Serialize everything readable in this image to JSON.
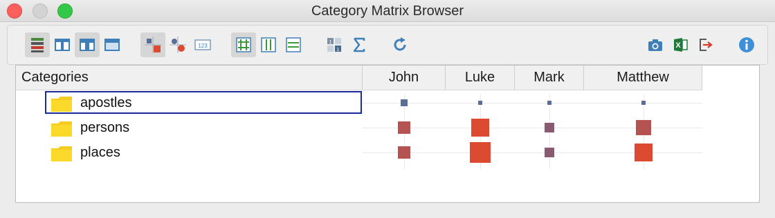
{
  "window": {
    "title": "Category Matrix Browser"
  },
  "toolbar": {
    "buttons": [
      {
        "name": "stacked-rows-icon",
        "active": true
      },
      {
        "name": "column-view-icon",
        "active": false
      },
      {
        "name": "column-view-2-icon",
        "active": true
      },
      {
        "name": "window-view-icon",
        "active": false
      },
      {
        "name": "symbol-squares-icon",
        "active": true
      },
      {
        "name": "symbol-circles-icon",
        "active": false
      },
      {
        "name": "numbers-icon",
        "active": false
      },
      {
        "name": "grid-hash-icon",
        "active": true
      },
      {
        "name": "columns-grid-icon",
        "active": false
      },
      {
        "name": "rows-grid-icon",
        "active": false
      },
      {
        "name": "numbered-grid-icon",
        "active": false
      },
      {
        "name": "sigma-icon",
        "active": false
      },
      {
        "name": "refresh-icon",
        "active": false
      },
      {
        "name": "camera-icon",
        "active": false
      },
      {
        "name": "excel-icon",
        "active": false
      },
      {
        "name": "export-icon",
        "active": false
      },
      {
        "name": "info-icon",
        "active": false
      }
    ]
  },
  "matrix": {
    "row_header": "Categories",
    "columns": [
      "John",
      "Luke",
      "Mark",
      "Matthew"
    ],
    "rows": [
      {
        "label": "apostles",
        "selected": true,
        "values": [
          2,
          1,
          1,
          1
        ]
      },
      {
        "label": "persons",
        "selected": false,
        "values": [
          4,
          6,
          3,
          5
        ]
      },
      {
        "label": "places",
        "selected": false,
        "values": [
          4,
          7,
          3,
          6
        ]
      }
    ],
    "colors": {
      "low": "#5b6f95",
      "mid": "#8a5a70",
      "high": "#b55252",
      "max": "#dd4a32"
    }
  }
}
